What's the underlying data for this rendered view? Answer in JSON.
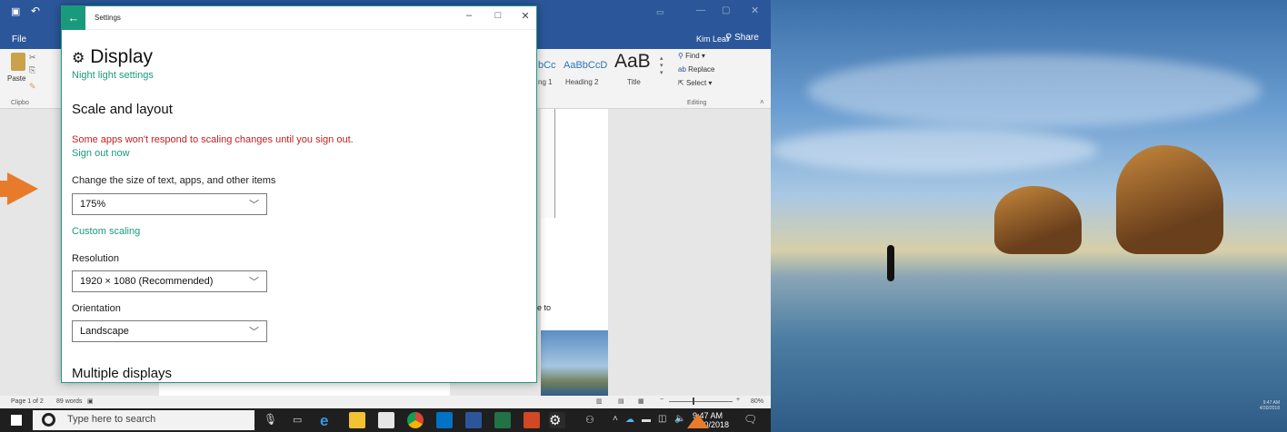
{
  "word": {
    "tab_file": "File",
    "user": "Kim Leaf",
    "share": "Share",
    "ribbon": {
      "paste": "Paste",
      "clipboard_group": "Clipbo",
      "styles": [
        "bCc",
        "AaBbCcD",
        "AaB"
      ],
      "style_names": [
        "ng 1",
        "Heading 2",
        "Title"
      ],
      "find": "Find",
      "replace": "Replace",
      "select": "Select",
      "editing_group": "Editing"
    },
    "doc_fragment": "e to",
    "status": {
      "page": "Page 1 of 2",
      "words": "89 words",
      "zoom": "80%"
    }
  },
  "settings": {
    "window_title": "Settings",
    "page_title": "Display",
    "night_light_link": "Night light settings",
    "scale_heading": "Scale and layout",
    "warning": "Some apps won't respond to scaling changes until you sign out.",
    "sign_out_link": "Sign out now",
    "size_label": "Change the size of text, apps, and other items",
    "size_value": "175%",
    "custom_scaling_link": "Custom scaling",
    "resolution_label": "Resolution",
    "resolution_value": "1920 × 1080 (Recommended)",
    "orientation_label": "Orientation",
    "orientation_value": "Landscape",
    "multiple_displays_heading": "Multiple displays"
  },
  "taskbar": {
    "search_placeholder": "Type here to search",
    "time": "9:47 AM",
    "date": "4/30/2018"
  },
  "taskbar_right": {
    "time": "9:47 AM",
    "date": "4/30/2018"
  },
  "colors": {
    "accent": "#1a9a7c",
    "warning": "#c41f1f",
    "arrow": "#e87b2b",
    "word_blue": "#2b579a"
  }
}
